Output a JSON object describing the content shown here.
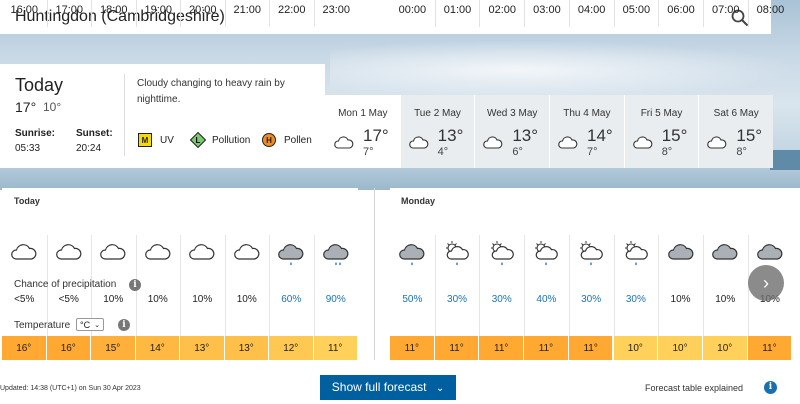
{
  "header": {
    "location": "Huntingdon (Cambridgeshire)"
  },
  "today": {
    "title": "Today",
    "high": "17°",
    "low": "10°",
    "sunrise_label": "Sunrise:",
    "sunrise": "05:33",
    "sunset_label": "Sunset:",
    "sunset": "20:24",
    "summary": "Cloudy changing to heavy rain by nighttime.",
    "uv_badge": "M",
    "uv_label": "UV",
    "pollution_badge": "L",
    "pollution_label": "Pollution",
    "pollen_badge": "H",
    "pollen_label": "Pollen"
  },
  "days": [
    {
      "name": "Mon 1 May",
      "high": "17°",
      "low": "7°"
    },
    {
      "name": "Tue 2 May",
      "high": "13°",
      "low": "4°"
    },
    {
      "name": "Wed 3 May",
      "high": "13°",
      "low": "6°"
    },
    {
      "name": "Thu 4 May",
      "high": "14°",
      "low": "7°"
    },
    {
      "name": "Fri 5 May",
      "high": "15°",
      "low": "8°"
    },
    {
      "name": "Sat 6 May",
      "high": "15°",
      "low": "8°"
    }
  ],
  "hourly_today": {
    "date_label": "Today",
    "hours": [
      "16:00",
      "17:00",
      "18:00",
      "19:00",
      "20:00",
      "21:00",
      "22:00",
      "23:00"
    ],
    "precip": [
      "<5%",
      "<5%",
      "10%",
      "10%",
      "10%",
      "10%",
      "60%",
      "90%"
    ],
    "temps": [
      "16°",
      "16°",
      "15°",
      "14°",
      "13°",
      "13°",
      "12°",
      "11°"
    ]
  },
  "hourly_monday": {
    "date_label": "Monday",
    "hours": [
      "00:00",
      "01:00",
      "02:00",
      "03:00",
      "04:00",
      "05:00",
      "06:00",
      "07:00",
      "08:00"
    ],
    "precip": [
      "50%",
      "30%",
      "30%",
      "40%",
      "30%",
      "30%",
      "10%",
      "10%",
      "10%"
    ],
    "temps": [
      "11°",
      "11°",
      "11°",
      "11°",
      "11°",
      "10°",
      "10°",
      "10°",
      "11°"
    ]
  },
  "labels": {
    "precip": "Chance of precipitation",
    "temperature": "Temperature",
    "unit": "°C",
    "updated": "Updated: 14:38 (UTC+1) on Sun 30 Apr 2023",
    "show_full": "Show full forecast",
    "explained": "Forecast table explained"
  },
  "colors": {
    "accent": "#005f9e",
    "rain_text": "#1a73b8",
    "uv_yellow": "#f5d90a",
    "pollution_green": "#7bc96f",
    "pollen_orange": "#f08a24"
  }
}
